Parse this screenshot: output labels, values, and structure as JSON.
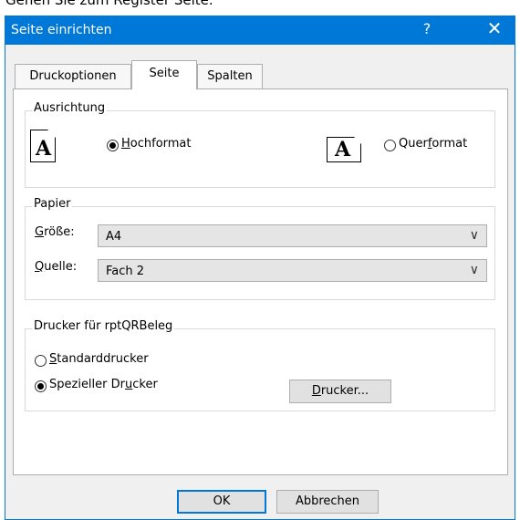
{
  "caption": "Gehen Sie zum Register Seite.",
  "window": {
    "title": "Seite einrichten",
    "help": "?",
    "close": "✕"
  },
  "tabs": [
    "Druckoptionen",
    "Seite",
    "Spalten"
  ],
  "orientation": {
    "group_label": "Ausrichtung",
    "icon_glyph": "A",
    "portrait": {
      "pre": "",
      "key": "H",
      "post": "ochformat",
      "checked": true
    },
    "landscape": {
      "pre": "Quer",
      "key": "f",
      "post": "ormat",
      "checked": false
    }
  },
  "paper": {
    "group_label": "Papier",
    "size": {
      "label_key": "G",
      "label_rest": "röße:",
      "value": "A4"
    },
    "source": {
      "label_key": "Q",
      "label_rest": "uelle:",
      "value": "Fach 2"
    }
  },
  "printer": {
    "group_label": "Drucker für rptQRBeleg",
    "standard": {
      "key": "S",
      "post": "tandarddrucker",
      "checked": false
    },
    "special": {
      "pre": "Spezieller Dr",
      "key": "u",
      "post": "cker",
      "checked": true
    },
    "button": {
      "key": "D",
      "post": "rucker..."
    }
  },
  "footer": {
    "ok": "OK",
    "cancel": "Abbrechen"
  }
}
